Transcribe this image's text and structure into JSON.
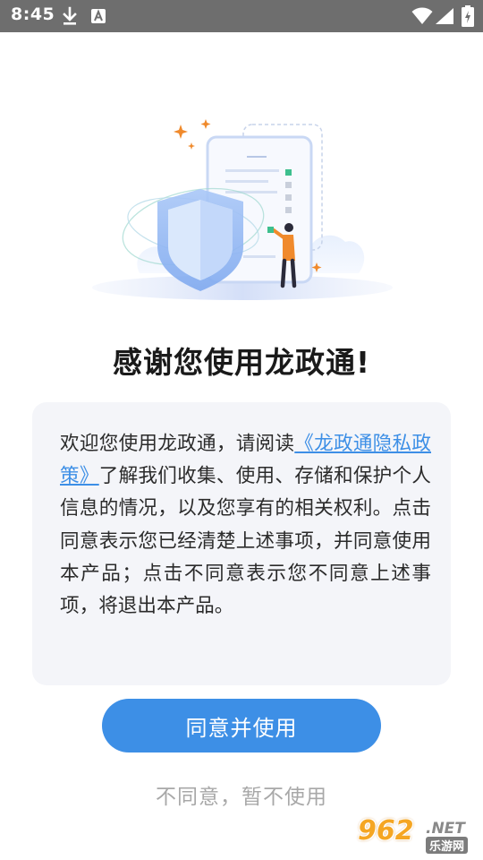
{
  "status_bar": {
    "time": "8:45",
    "icons": [
      "download-icon",
      "a-notification-icon",
      "wifi-icon",
      "signal-icon",
      "battery-icon"
    ]
  },
  "welcome": {
    "title": "感谢您使用龙政通!"
  },
  "policy": {
    "text_before": "欢迎您使用龙政通，请阅读",
    "link_label": "《龙政通隐私政策》",
    "text_after": "了解我们收集、使用、存储和保护个人信息的情况，以及您享有的相关权利。点击同意表示您已经清楚上述事项，并同意使用本产品；点击不同意表示您不同意上述事项，将退出本产品。"
  },
  "actions": {
    "agree_label": "同意并使用",
    "disagree_label": "不同意，暂不使用"
  },
  "watermark": {
    "number": "962",
    "suffix": ".NET",
    "site_name": "乐游网"
  },
  "colors": {
    "accent": "#3d8fe6",
    "status_bar": "#6e6e6e",
    "policy_bg": "#f4f5f9",
    "disagree_text": "#a8a8a8"
  }
}
